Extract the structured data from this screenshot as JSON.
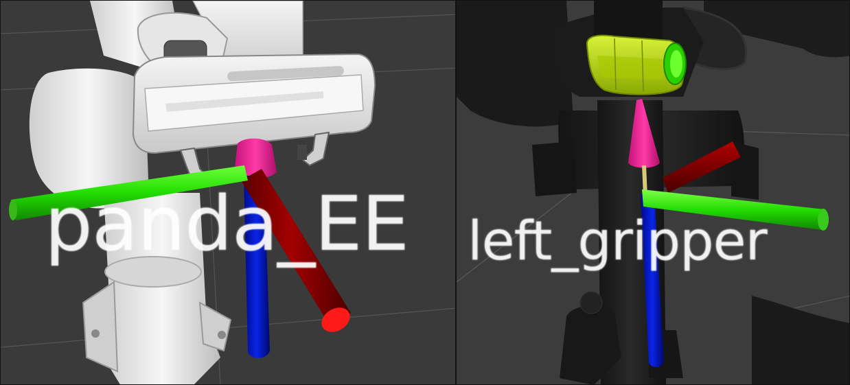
{
  "viewports": [
    {
      "id": "left",
      "frame_label": "panda_EE",
      "background": "#3a3a3a",
      "robot": "panda"
    },
    {
      "id": "right",
      "frame_label": "left_gripper",
      "background": "#3c3c3c",
      "robot": "baxter"
    }
  ],
  "colors": {
    "x_axis": "#8b0000",
    "y_axis": "#22dd00",
    "z_axis": "#0011cc",
    "ee_marker": "#ff2a9d",
    "gripper_highlight": "#b5e000",
    "grid_line": "#555555"
  }
}
